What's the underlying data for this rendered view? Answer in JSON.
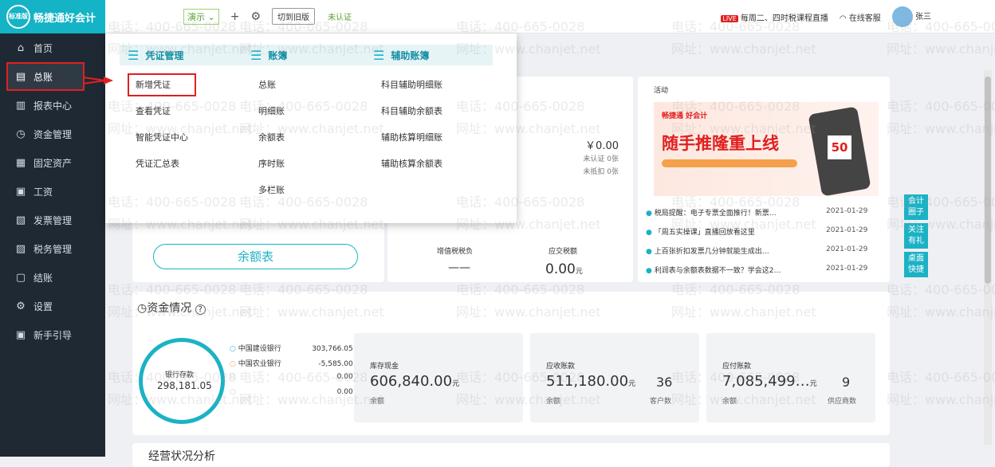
{
  "app": {
    "logo_badge": "标准版",
    "logo_text": "畅捷通好会计"
  },
  "sidebar": {
    "items": [
      {
        "label": "首页",
        "icon": "home-icon",
        "glyph": "⌂"
      },
      {
        "label": "总账",
        "icon": "ledger-icon",
        "glyph": "▤"
      },
      {
        "label": "报表中心",
        "icon": "chart-icon",
        "glyph": "▥"
      },
      {
        "label": "资金管理",
        "icon": "money-icon",
        "glyph": "◷"
      },
      {
        "label": "固定资产",
        "icon": "asset-icon",
        "glyph": "▦"
      },
      {
        "label": "工资",
        "icon": "salary-icon",
        "glyph": "▣"
      },
      {
        "label": "发票管理",
        "icon": "invoice-icon",
        "glyph": "▧"
      },
      {
        "label": "税务管理",
        "icon": "tax-icon",
        "glyph": "▨"
      },
      {
        "label": "结账",
        "icon": "checkout-icon",
        "glyph": "▢"
      },
      {
        "label": "设置",
        "icon": "gear-icon",
        "glyph": "⚙"
      },
      {
        "label": "新手引导",
        "icon": "guide-icon",
        "glyph": "▣"
      }
    ]
  },
  "topbar": {
    "demo_label": "演示",
    "add": "+",
    "settings": "⚙",
    "old_version": "切到旧版",
    "status": "未认证",
    "live_badge": "LIVE",
    "course": "每周二、四时税课程直播",
    "service": "在线客服",
    "user": "张三"
  },
  "dropdown": {
    "columns": [
      {
        "title": "凭证管理",
        "items": [
          "新增凭证",
          "查看凭证",
          "智能凭证中心",
          "凭证汇总表"
        ]
      },
      {
        "title": "账簿",
        "items": [
          "总账",
          "明细账",
          "余额表",
          "序时账",
          "多栏账"
        ]
      },
      {
        "title": "辅助账簿",
        "items": [
          "科目辅助明细账",
          "科目辅助余额表",
          "辅助核算明细账",
          "辅助核算余额表"
        ]
      }
    ]
  },
  "overview": {
    "amount": "￥0.00",
    "unverified": "未认证 0张",
    "undeducted": "未抵扣 0张",
    "balance_btn": "余额表",
    "vat_label": "增值税税负",
    "vat_value": "——",
    "tax_label": "应交税额",
    "tax_value": "0.00",
    "tax_unit": "元"
  },
  "activity": {
    "title": "活动",
    "promo_brand": "畅捷通 好会计",
    "promo_headline": "随手推隆重上线",
    "promo_badge": "50",
    "news": [
      {
        "text": "税局提醒：电子专票全面推行！新票…",
        "date": "2021-01-29"
      },
      {
        "text": "「周五实操课」直播回放看这里",
        "date": "2021-01-29"
      },
      {
        "text": "上百张折扣发票几分钟就能生成出…",
        "date": "2021-01-29"
      },
      {
        "text": "利润表与余额表数据不一致？学会这2…",
        "date": "2021-01-29"
      }
    ]
  },
  "side_tabs": [
    "会计圈子",
    "关注有礼",
    "桌面快捷"
  ],
  "funds": {
    "title": "资金情况",
    "help": "?",
    "bank_label": "银行存款",
    "bank_value": "298,181.05",
    "banks": [
      {
        "name": "中国建设银行",
        "value": "303,766.05"
      },
      {
        "name": "中国农业银行",
        "value": "-5,585.00"
      },
      {
        "name": "",
        "value": "0.00"
      },
      {
        "name": "",
        "value": "0.00"
      }
    ],
    "cash": {
      "label": "库存现金",
      "value": "606,840.00",
      "unit": "元",
      "sub": "余额"
    },
    "receivable": {
      "label": "应收账款",
      "value": "511,180.00",
      "unit": "元",
      "sub": "余额",
      "count": "36",
      "count_label": "客户数"
    },
    "payable": {
      "label": "应付账款",
      "value": "7,085,499…",
      "unit": "元",
      "sub": "余额",
      "count": "9",
      "count_label": "供应商数"
    }
  },
  "bottom_title": "经营状况分析",
  "watermark": {
    "phone": "电话：400-665-0028",
    "site": "网址：www.chanjet.net"
  }
}
